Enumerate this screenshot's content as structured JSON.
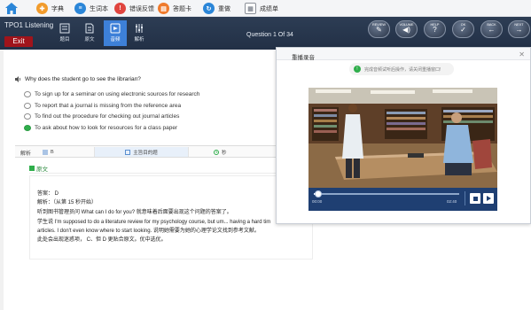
{
  "topbar": {
    "items": [
      {
        "label": "字典",
        "icon": "book-icon",
        "color": "#f19b2c"
      },
      {
        "label": "生词本",
        "icon": "notebook-icon",
        "color": "#2b86d8"
      },
      {
        "label": "错误反馈",
        "icon": "feedback-icon",
        "color": "#e0453f"
      },
      {
        "label": "答题卡",
        "icon": "answer-card-icon",
        "color": "#ef7a2c"
      },
      {
        "label": "重做",
        "icon": "redo-icon",
        "color": "#2b86d8"
      },
      {
        "label": "成绩单",
        "icon": "report-card-icon",
        "color": "#8a8f98"
      }
    ]
  },
  "header": {
    "title": "TPO1  Listening",
    "exit_label": "Exit",
    "question_counter": "Question 1 Of  34",
    "tabs": [
      {
        "label": "题目",
        "icon": "question-list-icon"
      },
      {
        "label": "原文",
        "icon": "document-icon"
      },
      {
        "label": "音频",
        "icon": "audio-icon"
      },
      {
        "label": "解析",
        "icon": "analysis-icon"
      }
    ],
    "active_tab": "音频",
    "nav_buttons": [
      {
        "label": "REVIEW",
        "glyph": "✎"
      },
      {
        "label": "VOLUME",
        "glyph": "◀)"
      },
      {
        "label": "HELP",
        "glyph": "?"
      },
      {
        "label": "OK",
        "glyph": "✓"
      },
      {
        "label": "BACK",
        "glyph": "←"
      },
      {
        "label": "NEXT",
        "glyph": "→"
      }
    ]
  },
  "question": {
    "text": "Why does the student go to see the librarian?",
    "options": [
      {
        "text": "To sign up for a seminar on using electronic sources for research",
        "selected": false
      },
      {
        "text": "To report that a journal is missing from the reference area",
        "selected": false
      },
      {
        "text": "To find out the procedure for checking out journal articles",
        "selected": false
      },
      {
        "text": "To ask about how to look for resources for a class paper",
        "selected": true
      }
    ]
  },
  "analysis_bar": {
    "label": "解析",
    "segments": [
      {
        "label": "B",
        "icon": "list-icon"
      },
      {
        "label": "主旨目的题",
        "icon": "tag-icon"
      },
      {
        "label": "秒",
        "icon": "clock-icon"
      }
    ]
  },
  "original_tab_label": "原文",
  "analysis_text": {
    "answer": "答案：  D",
    "explain": "解析：（从第 15 秒开始）",
    "line1": "听到图书管理员问 What can I do for you? 就意味着后面要出现这个问题的答案了。",
    "line2": "学生说 I'm supposed to do a literature review for my psychology course, but um... having a hard tim",
    "line3": "articles. I don't even know where to start looking. 说明她需要为她的心理学论文找到参考文献。",
    "line4": "此处会出现迷惑项， C、但 D 更贴合原文。优中选优。"
  },
  "popup": {
    "title": "重播录音",
    "hint": "完成音频试听后操作，请关闭重播窗口!",
    "time_current": "00:00",
    "time_total": "02:40",
    "progress": 0.03
  },
  "colors": {
    "header_bg": "#2a3950",
    "exit_red": "#a0141b",
    "active_tab": "#3d80d8",
    "selected_green": "#2fae4b",
    "player_bg": "#1f3f72"
  }
}
